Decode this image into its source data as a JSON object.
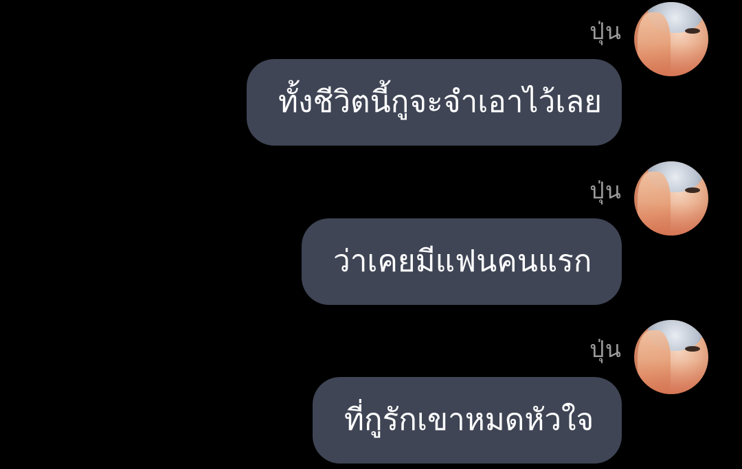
{
  "messages": [
    {
      "sender": "ปุ่น",
      "text": "ทั้งชีวิตนี้กูจะจำเอาไว้เลย"
    },
    {
      "sender": "ปุ่น",
      "text": "ว่าเคยมีแฟนคนแรก"
    },
    {
      "sender": "ปุ่น",
      "text": "ที่กูรักเขาหมดหัวใจ"
    }
  ],
  "colors": {
    "background": "#000000",
    "bubble": "#3f4555",
    "bubble_text": "#ffffff",
    "sender_name": "#9a9a9a"
  }
}
